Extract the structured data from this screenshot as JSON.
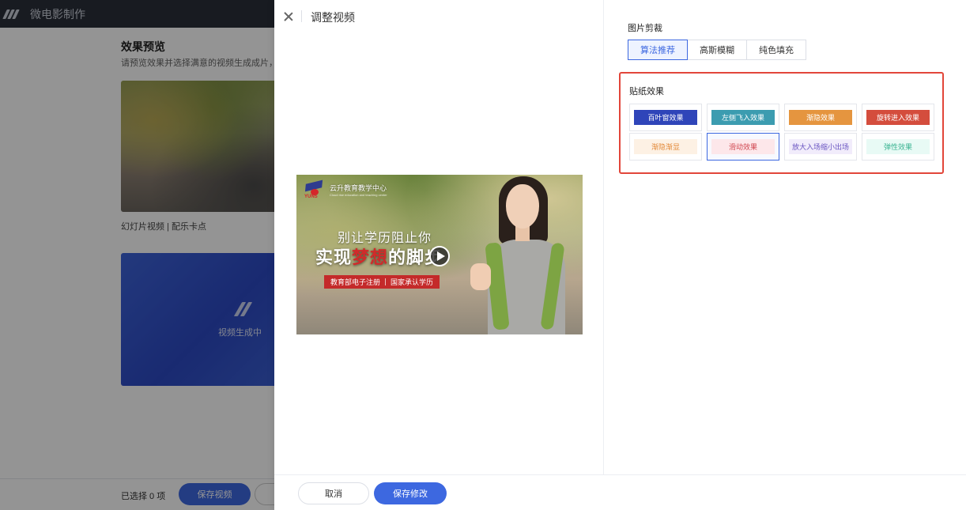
{
  "app": {
    "title": "微电影制作"
  },
  "background": {
    "section_title": "效果预览",
    "section_sub": "请预览效果并选择满意的视频生成成片，你",
    "card1_label": "幻灯片视频 | 配乐卡点",
    "card2_text": "视频生成中",
    "selected_text": "已选择 0 项",
    "save_video_label": "保存视频"
  },
  "drawer": {
    "title": "调整视频",
    "preview": {
      "brand_name": "云升教育教学中心",
      "brand_sub": "Cloud rise education and teaching center",
      "logo_text": "YUNS",
      "slogan_line1": "别让学历阻止你",
      "slogan_line2_a": "实现",
      "slogan_line2_b": "梦想",
      "slogan_line2_c": "的脚步",
      "tag1": "教育部电子注册",
      "tag2": "国家承认学历"
    },
    "crop": {
      "title": "图片剪裁",
      "options": [
        "算法推荐",
        "高斯模糊",
        "纯色填充"
      ],
      "selected": "算法推荐"
    },
    "stickers": {
      "title": "贴纸效果",
      "items": [
        {
          "label": "百叶窗效果",
          "bg": "#2f45b9",
          "fg": "#ffffff"
        },
        {
          "label": "左侧飞入效果",
          "bg": "#3c9cb0",
          "fg": "#ffffff"
        },
        {
          "label": "渐隐效果",
          "bg": "#e5953f",
          "fg": "#ffffff"
        },
        {
          "label": "旋转进入效果",
          "bg": "#d44d3d",
          "fg": "#ffffff"
        },
        {
          "label": "渐隐渐显",
          "bg": "#fdf1e4",
          "fg": "#e38a3a"
        },
        {
          "label": "滑动效果",
          "bg": "#fde7ea",
          "fg": "#d0454f"
        },
        {
          "label": "放大入场缩小出场",
          "bg": "#f1ecfb",
          "fg": "#6a55c2"
        },
        {
          "label": "弹性效果",
          "bg": "#e8faf5",
          "fg": "#3bb492"
        }
      ],
      "selected_index": 5
    },
    "footer": {
      "cancel": "取消",
      "save": "保存修改"
    }
  },
  "colors": {
    "accent": "#3d68e0",
    "highlight_border": "#e2463a"
  }
}
